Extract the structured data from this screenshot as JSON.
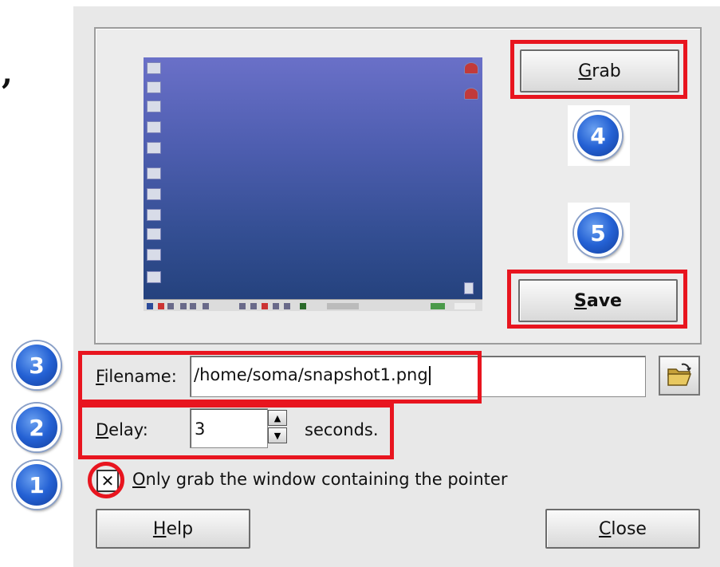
{
  "decor": {
    "comma": ","
  },
  "buttons": {
    "grab": {
      "pre": "",
      "mnemonic": "G",
      "post": "rab"
    },
    "save": {
      "pre": "",
      "mnemonic": "S",
      "post": "ave"
    },
    "help": {
      "pre": "",
      "mnemonic": "H",
      "post": "elp"
    },
    "close": {
      "pre": "",
      "mnemonic": "C",
      "post": "lose"
    }
  },
  "steps": [
    "1",
    "2",
    "3",
    "4",
    "5"
  ],
  "filename": {
    "label_mnemonic": "F",
    "label_rest": "ilename:",
    "value": "/home/soma/snapshot1.png"
  },
  "delay": {
    "label_mnemonic": "D",
    "label_rest": "elay:",
    "value": "3",
    "unit": "seconds."
  },
  "checkbox": {
    "checked": true,
    "mark": "✕",
    "label_mnemonic": "O",
    "label_rest": "nly grab the window containing the pointer"
  },
  "icons": {
    "folder": "folder-open-icon",
    "spin_up": "spin-up-icon",
    "spin_down": "spin-down-icon"
  },
  "colors": {
    "annotation_red": "#e8151f",
    "badge_blue": "#2461d4",
    "panel_bg": "#e8e8e8"
  }
}
